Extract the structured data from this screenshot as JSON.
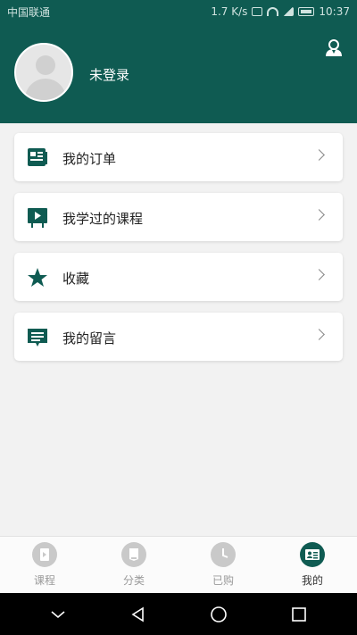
{
  "status_bar": {
    "carrier": "中国联通",
    "speed": "1.7 K/s",
    "time": "10:37"
  },
  "header": {
    "login_status": "未登录"
  },
  "menu": {
    "items": [
      {
        "label": "我的订单",
        "icon": "orders-icon"
      },
      {
        "label": "我学过的课程",
        "icon": "learned-courses-icon"
      },
      {
        "label": "收藏",
        "icon": "star-icon"
      },
      {
        "label": "我的留言",
        "icon": "message-icon"
      }
    ]
  },
  "tabbar": {
    "items": [
      {
        "label": "课程",
        "icon": "course-icon",
        "active": false
      },
      {
        "label": "分类",
        "icon": "category-icon",
        "active": false
      },
      {
        "label": "已购",
        "icon": "clock-icon",
        "active": false
      },
      {
        "label": "我的",
        "icon": "profile-card-icon",
        "active": true
      }
    ]
  },
  "colors": {
    "brand": "#0f5b52",
    "background": "#f2f2f2",
    "inactive": "#c9c9c9"
  }
}
